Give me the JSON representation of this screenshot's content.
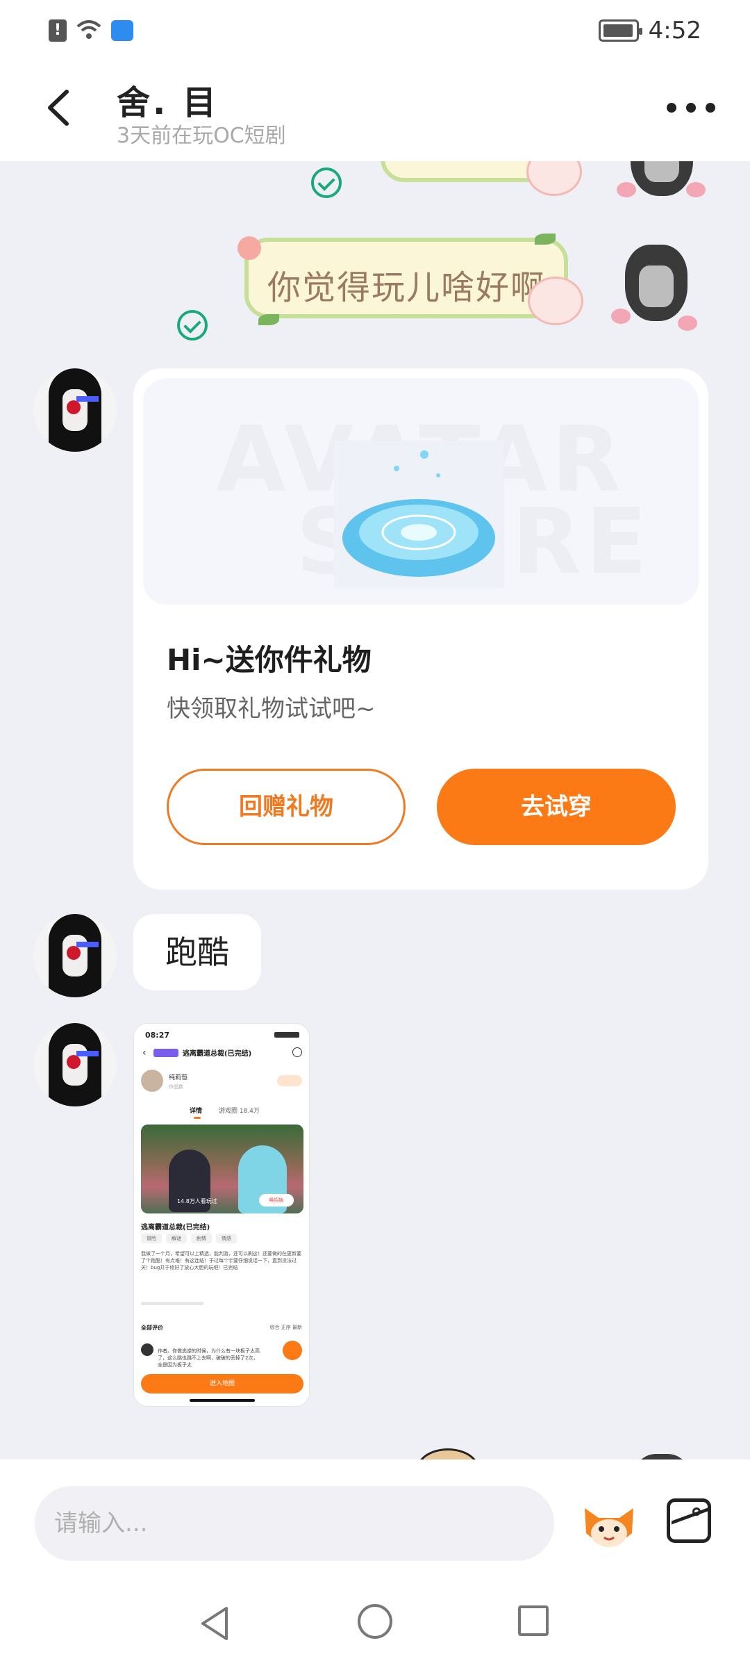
{
  "status_bar": {
    "time": "4:52"
  },
  "header": {
    "title": "舍. 目",
    "subtitle": "3天前在玩OC短剧"
  },
  "messages": {
    "sticker_text": "你觉得玩儿啥好啊",
    "gift_card": {
      "title": "Hi~送你件礼物",
      "subtitle": "快领取礼物试试吧~",
      "watermark": "AVATAR",
      "watermark2": "STORE",
      "return_button": "回赠礼物",
      "try_button": "去试穿"
    },
    "text_message": "跑酷",
    "screenshot": {
      "time": "08:27",
      "title": "逃离霸道总裁(已完结)",
      "author": "纯莉苞",
      "role": "作品数",
      "tab_details": "详情",
      "tab_gamecircle": "游戏圈 18.4万",
      "hero_count": "14.8万人看玩过",
      "hero_button": "唤招始",
      "game_title": "逃离霸道总裁(已完结)",
      "chips": [
        "冒险",
        "解谜",
        "剧情",
        "情感"
      ],
      "description": "我做了一个月，希望可以上精选，能判游，还可以刷这！还要做的在更新要了个跑酷！有点难！有这连结！于过每个宇要仔细说话一下，直到没法过关！bug并于修好了放心大胆的玩吧！已完结",
      "reviews_label": "全部评价",
      "review_tabs": "综合  正序  最新",
      "comment": "作者。你做逃逆的时候，为什么有一块板子太高了，这么跳也跳不上去啊，破破的丢掉了2次，全是因为板子太",
      "enter_button": "进入地图"
    }
  },
  "input_bar": {
    "placeholder": "请输入..."
  }
}
